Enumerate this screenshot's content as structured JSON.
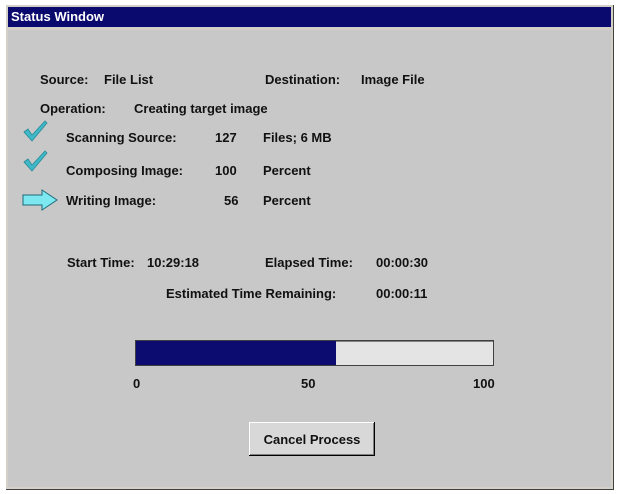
{
  "window": {
    "title": "Status Window"
  },
  "source": {
    "label": "Source:",
    "value": "File List"
  },
  "destination": {
    "label": "Destination:",
    "value": "Image File"
  },
  "operation": {
    "label": "Operation:",
    "value": "Creating target image"
  },
  "steps": [
    {
      "label": "Scanning Source:",
      "value": "127",
      "unit": "Files;  6 MB",
      "status": "done",
      "icon": "checkmark-icon"
    },
    {
      "label": "Composing Image:",
      "value": "100",
      "unit": "Percent",
      "status": "done",
      "icon": "checkmark-icon"
    },
    {
      "label": "Writing Image:",
      "value": "56",
      "unit": "Percent",
      "status": "in-progress",
      "icon": "arrow-right-icon"
    }
  ],
  "timing": {
    "start_label": "Start Time:",
    "start_value": "10:29:18",
    "elapsed_label": "Elapsed Time:",
    "elapsed_value": "00:00:30",
    "remaining_label": "Estimated Time Remaining:",
    "remaining_value": "00:00:11"
  },
  "progress": {
    "percent": 56,
    "scale": [
      "0",
      "50",
      "100"
    ]
  },
  "cancel_button": {
    "label": "Cancel Process"
  },
  "colors": {
    "titlebar": "#0a0a6e",
    "progress_fill": "#0c0c70",
    "check": "#3fb8c8",
    "arrow": "#7ee8f0"
  }
}
